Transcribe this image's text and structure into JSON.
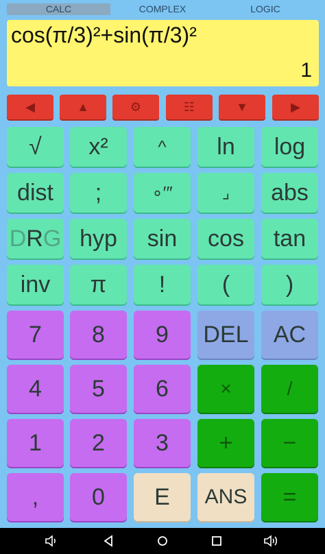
{
  "tabs": [
    "CALC",
    "COMPLEX",
    "LOGIC"
  ],
  "display": {
    "expression": "cos(π/3)²+sin(π/3)²",
    "result": "1"
  },
  "nav_buttons": [
    "◀",
    "▲",
    "⚙",
    "☷",
    "▼",
    "▶"
  ],
  "keys": {
    "sqrt": "√",
    "square": "x²",
    "power": "^",
    "ln": "ln",
    "log": "log",
    "dist": "dist",
    "semicolon": ";",
    "dms": "∘′″",
    "fraction": "⌟",
    "abs": "abs",
    "drg_d": "D",
    "drg_r": "R",
    "drg_g": "G",
    "hyp": "hyp",
    "sin": "sin",
    "cos": "cos",
    "tan": "tan",
    "inv": "inv",
    "pi": "π",
    "factorial": "!",
    "lparen": "(",
    "rparen": ")",
    "d7": "7",
    "d8": "8",
    "d9": "9",
    "del": "DEL",
    "ac": "AC",
    "d4": "4",
    "d5": "5",
    "d6": "6",
    "multiply": "×",
    "divide": "/",
    "d1": "1",
    "d2": "2",
    "d3": "3",
    "plus": "+",
    "minus": "−",
    "comma": ",",
    "d0": "0",
    "exp": "E",
    "ans": "ANS",
    "equals": "="
  },
  "system_bar": [
    "volume-down-icon",
    "back-icon",
    "home-icon",
    "recents-icon",
    "volume-up-icon"
  ]
}
